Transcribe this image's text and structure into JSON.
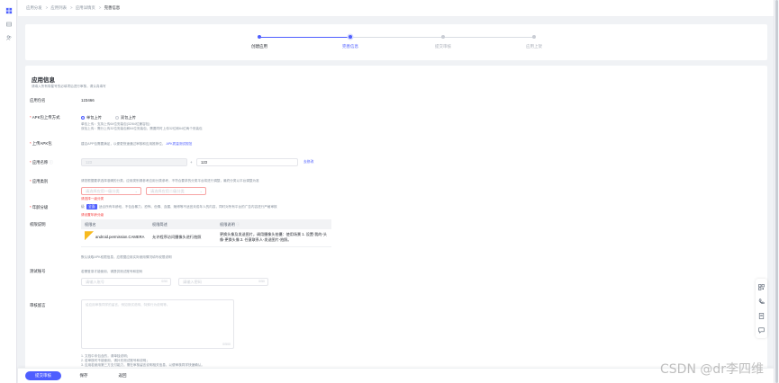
{
  "breadcrumb": [
    "应用分发",
    "应用列表",
    "应用详情页",
    "完善信息"
  ],
  "steps": [
    {
      "label": "创建应用",
      "state": "done"
    },
    {
      "label": "完善信息",
      "state": "active"
    },
    {
      "label": "提交审核",
      "state": "todo"
    },
    {
      "label": "应用上架",
      "state": "todo"
    }
  ],
  "form": {
    "title": "应用信息",
    "subtitle": "请填入所有带星号的必填项后进行审核，请认真填写",
    "package_label": "应用包名",
    "package_value": "123466",
    "apk_mode_label": "APK包上传方式",
    "apk_mode_options": [
      "单包上传",
      "双包上传"
    ],
    "apk_mode_hint1": "单包上传：支持上传64位安装包(32/64位兼容包)",
    "apk_mode_hint2": "双包上传：需分上传32位安装包和64位安装包，需要同时上传32位和64位两个安装包",
    "upload_label": "上传APK包",
    "upload_hint": "建议APP包需要满足，以便更快速通过审核和应用推荐位，",
    "upload_link": "APK质量测试规范",
    "appname_label": "应用名称",
    "appname_prefix": "123",
    "appname_value": "123",
    "appname_link": "去修改",
    "category_label": "应用类别",
    "category_hint": "请您根据要求选择准确的分类，应用类别请参考应用分类参考，不符合要求的分类平台将进行调整，最终分类以平台调整为准",
    "category_link": "应用分类参考",
    "category_select1": "请选择应用一级分类",
    "category_select2": "请选择应用二级分类",
    "category_error": "请选择一级分类",
    "age_label": "年龄分级",
    "age_tag": "全面",
    "age_hint": "适合所有年龄段，不包含暴力、恐怖、色情、血腥、赌博等不适宜未成年人的内容，同时对所有平台的广告内容进行严格审核",
    "age_error": "请设置年龄分级",
    "perm_label": "权限说明",
    "perm_headers": [
      "权限名",
      "权限简述",
      "权限说明"
    ],
    "perm_rows": [
      {
        "name": "android.permission.CAMERA",
        "brief": "允许程序访问摄像头进行拍照",
        "desc": "更换头像及发送图片，调用摄像头拍摄：使用场景 1. 设置-我的-头像-更换头像 2. 任意联系人-发送图片-拍照。"
      }
    ],
    "perm_note": "默认读取APK权限信息，应根据应用实际使用情况填写权限说明",
    "test_label": "测试账号",
    "test_hint": "若需登录才能使用，请提供测试账号和密码",
    "test_account_ph": "请输入账号",
    "test_password_ph": "请输入密码",
    "test_account_count": "0/50",
    "test_password_count": "0/50",
    "remark_label": "审核留言",
    "remark_ph": "给应用审核同学的留言，例如测试说明、特殊行为说明等。",
    "remark_count": "0/500",
    "tips": [
      "1. 文档中未包含的，请单独说明；",
      "2. 若审核时不能使用，请补充测试账号和说明；",
      "3. 应用若使用第三方支付能力，需在审核留言说明相关信息，以便审核同学快速确认。"
    ]
  },
  "footer": {
    "submit": "提交审核",
    "save": "保存",
    "back": "返回"
  },
  "watermark": "CSDN @dr李四维",
  "colors": {
    "accent": "#4e5eff",
    "error": "#f53f3f",
    "warn": "#f7ba1e"
  }
}
